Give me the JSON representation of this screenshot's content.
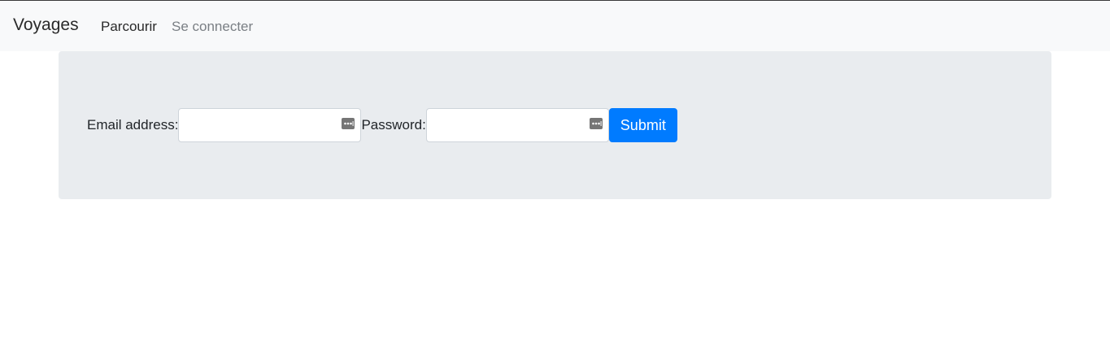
{
  "navbar": {
    "brand": "Voyages",
    "links": [
      {
        "label": "Parcourir"
      },
      {
        "label": "Se connecter"
      }
    ]
  },
  "login_form": {
    "email_label": "Email address:",
    "email_value": "",
    "password_label": "Password:",
    "password_value": "",
    "submit_label": "Submit",
    "field_icon": "password-manager-key-icon"
  },
  "colors": {
    "navbar_bg": "#f8f9fa",
    "jumbotron_bg": "#e9ecef",
    "primary": "#007bff",
    "muted_link": "#7a7f84"
  }
}
